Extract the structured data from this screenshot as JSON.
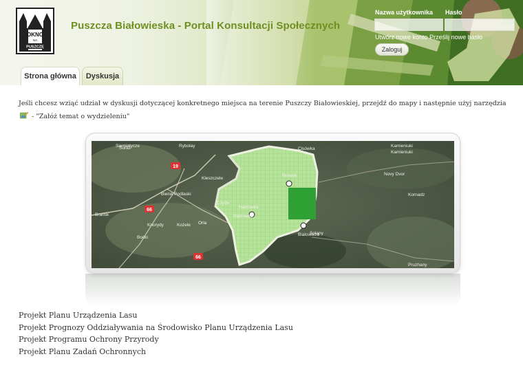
{
  "header": {
    "title": "Puszcza Białowieska - Portal Konsultacji Społecznych",
    "logo": {
      "line1": "OKNO",
      "line2": "NA",
      "line3": "PUSZCZĘ"
    }
  },
  "login": {
    "username_label": "Nazwa użytkownika",
    "password_label": "Hasło",
    "username_value": "",
    "password_value": "",
    "create_account_link": "Utwórz nowe konto",
    "send_password_link": "Prześlij nowe hasło",
    "submit_label": "Zaloguj"
  },
  "tabs": [
    {
      "label": "Strona główna",
      "active": true
    },
    {
      "label": "Dyskusja",
      "active": false
    }
  ],
  "intro": {
    "text_before_icon": "Jeśli chcesz wziąć udział w dyskusji dotyczącej konkretnego miejsca na terenie Puszczy Białowieskiej, przejdź do mapy i następnie użyj narzędzia",
    "text_after_icon": " - \"Załóż temat o wydzieleniu\"",
    "tool_icon": "map-edit-icon"
  },
  "map": {
    "places": [
      "Siemiatycze",
      "Suraż",
      "Rybołay",
      "Kleszczele",
      "Bielsk Podlaski",
      "Brańsk",
      "Knorydy",
      "Kożele",
      "Orla",
      "Boćki",
      "Czyże",
      "Hajnówka",
      "Hajnówka",
      "Białowieża",
      "Cisówka",
      "Browsk",
      "Novy Dvor",
      "Kamieniuki",
      "Kamieniuki",
      "Kornadz",
      "Pruzhany",
      "Solany"
    ],
    "road_numbers": [
      "19",
      "66",
      "66",
      "66",
      "19"
    ],
    "colors": {
      "forest_light": "#b6e39a",
      "forest_dark": "#2fa033",
      "boundary": "#e9ece0",
      "satellite": "#4f5b45"
    }
  },
  "documents": [
    "Projekt Planu Urządzenia Lasu",
    "Projekt Prognozy Oddziaływania na Środowisko Planu Urządzenia Lasu",
    "Projekt Programu Ochrony Przyrody",
    "Projekt Planu Zadań Ochronnych"
  ]
}
